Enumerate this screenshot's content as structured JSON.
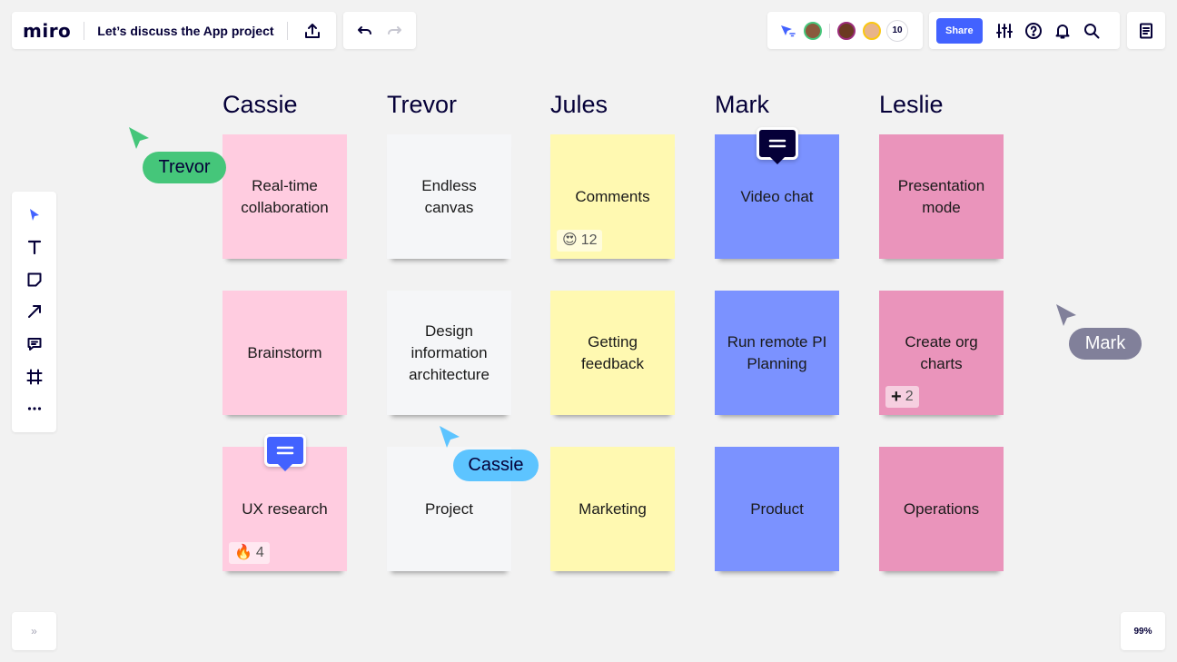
{
  "header": {
    "logo": "miro",
    "board_title": "Let’s discuss the App project",
    "collaborators_count": "10",
    "share_label": "Share"
  },
  "toolbar": {
    "tools": [
      "select-icon",
      "text-icon",
      "sticky-note-icon",
      "arrow-line-icon",
      "comment-icon",
      "frame-icon",
      "more-icon"
    ]
  },
  "footer": {
    "expand_label": "»",
    "zoom": "99%"
  },
  "columns": [
    {
      "name": "Cassie",
      "color": "#ffcce0",
      "notes": [
        "Real-time collaboration",
        "Brainstorm",
        "UX research"
      ]
    },
    {
      "name": "Trevor",
      "color": "#f5f6f8",
      "notes": [
        "Endless canvas",
        "Design information architecture",
        "Project"
      ]
    },
    {
      "name": "Jules",
      "color": "#fff9b1",
      "notes": [
        "Comments",
        "Getting feedback",
        "Marketing"
      ]
    },
    {
      "name": "Mark",
      "color": "#7b92ff",
      "notes": [
        "Video chat",
        "Run remote PI Planning",
        "Product"
      ]
    },
    {
      "name": "Leslie",
      "color": "#ea94bb",
      "notes": [
        "Presentation mode",
        "Create org charts",
        "Operations"
      ]
    }
  ],
  "reactions": {
    "comments": {
      "emoji": "😍",
      "count": "12"
    },
    "org_charts": {
      "emoji": "+",
      "count": "2"
    },
    "ux_research": {
      "emoji": "🔥",
      "count": "4"
    }
  },
  "cursors": {
    "trevor": {
      "name": "Trevor",
      "color": "#45c67a"
    },
    "cassie": {
      "name": "Cassie",
      "color": "#5dc4ff"
    },
    "mark": {
      "name": "Mark",
      "color": "#81809a"
    }
  }
}
